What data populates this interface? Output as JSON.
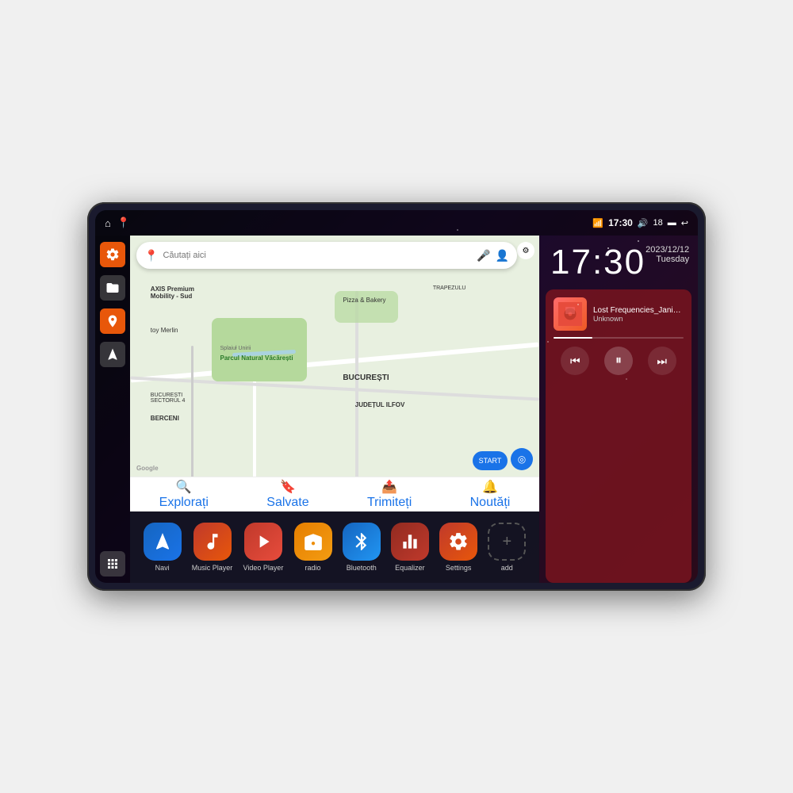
{
  "device": {
    "status_bar": {
      "wifi_icon": "▼",
      "time": "17:30",
      "volume_icon": "🔊",
      "battery_level": "18",
      "battery_icon": "🔋",
      "back_icon": "↩"
    },
    "clock": {
      "time": "17:30",
      "date": "2023/12/12",
      "day": "Tuesday"
    },
    "music": {
      "title": "Lost Frequencies_Janie...",
      "artist": "Unknown",
      "album_art_emoji": "🎵"
    },
    "map": {
      "search_placeholder": "Căutați aici",
      "labels": [
        "AXIS Premium Mobility - Sud",
        "Pizza & Bakery",
        "TRAPEZULU",
        "Parcul Natural Văcărești",
        "BUCUREȘTI",
        "SECTORUL 4",
        "JUDEȚUL ILFOV",
        "BERCENI",
        "Splaiuł Unirii",
        "toy Merlin"
      ],
      "bottom_items": [
        {
          "icon": "📍",
          "label": "Explorați"
        },
        {
          "icon": "🔖",
          "label": "Salvate"
        },
        {
          "icon": "📤",
          "label": "Trimiteți"
        },
        {
          "icon": "🔔",
          "label": "Noutăți"
        }
      ]
    },
    "sidebar": {
      "items": [
        {
          "icon": "⚙",
          "type": "orange",
          "name": "settings"
        },
        {
          "icon": "📁",
          "type": "gray",
          "name": "files"
        },
        {
          "icon": "📍",
          "type": "orange",
          "name": "location"
        },
        {
          "icon": "➤",
          "type": "gray",
          "name": "navigate"
        }
      ],
      "bottom": {
        "icon": "⊞",
        "name": "apps"
      }
    },
    "apps": [
      {
        "label": "Navi",
        "icon": "➤",
        "color": "#1a73e8",
        "name": "navi"
      },
      {
        "label": "Music Player",
        "icon": "🎵",
        "color": "#e8570a",
        "name": "music-player"
      },
      {
        "label": "Video Player",
        "icon": "▶",
        "color": "#e8570a",
        "name": "video-player"
      },
      {
        "label": "radio",
        "icon": "📻",
        "color": "#e87000",
        "name": "radio"
      },
      {
        "label": "Bluetooth",
        "icon": "🔷",
        "color": "#1a73e8",
        "name": "bluetooth"
      },
      {
        "label": "Equalizer",
        "icon": "🎚",
        "color": "#c0392b",
        "name": "equalizer"
      },
      {
        "label": "Settings",
        "icon": "⚙",
        "color": "#e8570a",
        "name": "settings-app"
      },
      {
        "label": "add",
        "icon": "+",
        "color": "transparent",
        "name": "add-app"
      }
    ]
  }
}
